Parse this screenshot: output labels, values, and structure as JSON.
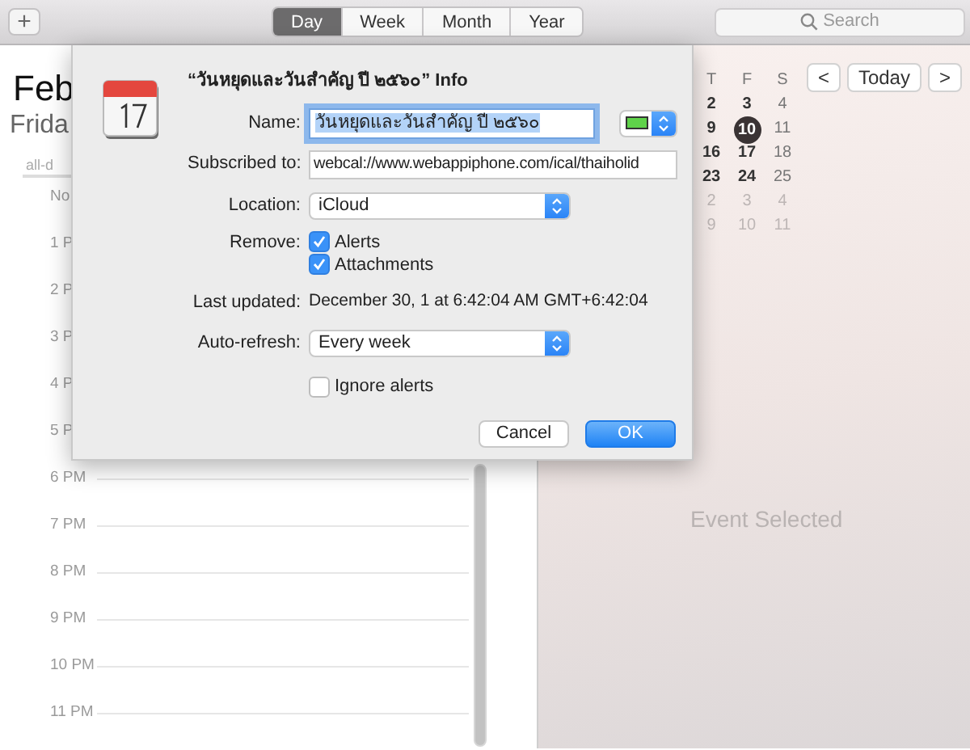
{
  "toolbar": {
    "add_button": "+",
    "view_tabs": [
      {
        "label": "Day",
        "selected": true
      },
      {
        "label": "Week",
        "selected": false
      },
      {
        "label": "Month",
        "selected": false
      },
      {
        "label": "Year",
        "selected": false
      }
    ],
    "search": {
      "placeholder": "Search"
    }
  },
  "day_view": {
    "month": "Feb",
    "weekday": "Frida",
    "all_day": "all-d",
    "hours": [
      "No",
      "1 P",
      "2 P",
      "3 P",
      "4 P",
      "5 P",
      "6 PM",
      "7 PM",
      "8 PM",
      "9 PM",
      "10 PM",
      "11 PM"
    ]
  },
  "mini_calendar": {
    "weekdays": [
      "T",
      "F",
      "S"
    ],
    "weeks": [
      [
        {
          "text": "2",
          "kind": "current",
          "selected": false
        },
        {
          "text": "3",
          "kind": "current",
          "selected": false
        },
        {
          "text": "4",
          "kind": "weekend",
          "selected": false
        }
      ],
      [
        {
          "text": "9",
          "kind": "current",
          "selected": false
        },
        {
          "text": "10",
          "kind": "current",
          "selected": true
        },
        {
          "text": "11",
          "kind": "weekend",
          "selected": false
        }
      ],
      [
        {
          "text": "16",
          "kind": "current",
          "selected": false
        },
        {
          "text": "17",
          "kind": "current",
          "selected": false
        },
        {
          "text": "18",
          "kind": "weekend",
          "selected": false
        }
      ],
      [
        {
          "text": "23",
          "kind": "current",
          "selected": false
        },
        {
          "text": "24",
          "kind": "current",
          "selected": false
        },
        {
          "text": "25",
          "kind": "weekend",
          "selected": false
        }
      ],
      [
        {
          "text": "2",
          "kind": "other",
          "selected": false
        },
        {
          "text": "3",
          "kind": "other",
          "selected": false
        },
        {
          "text": "4",
          "kind": "other",
          "selected": false
        }
      ],
      [
        {
          "text": "9",
          "kind": "other",
          "selected": false
        },
        {
          "text": "10",
          "kind": "other",
          "selected": false
        },
        {
          "text": "11",
          "kind": "other",
          "selected": false
        }
      ]
    ]
  },
  "navigation": {
    "previous": "<",
    "today": "Today",
    "next": ">"
  },
  "inspector": {
    "message": "Event Selected"
  },
  "dialog": {
    "title": "“วันหยุดและวันสำคัญ ปี ๒๕๖๐” Info",
    "name": {
      "label": "Name:",
      "value": "วันหยุดและวันสำคัญ ปี ๒๕๖๐",
      "selected": true,
      "color": "#5fd34a"
    },
    "subscribed": {
      "label": "Subscribed to:",
      "value": "webcal://www.webappiphone.com/ical/thaiholid"
    },
    "location": {
      "label": "Location:",
      "value": "iCloud"
    },
    "remove": {
      "label": "Remove:",
      "options": [
        {
          "label": "Alerts",
          "checked": true
        },
        {
          "label": "Attachments",
          "checked": true
        }
      ]
    },
    "last_updated": {
      "label": "Last updated:",
      "value": "December 30, 1 at 6:42:04 AM GMT+6:42:04"
    },
    "auto_refresh": {
      "label": "Auto-refresh:",
      "value": "Every week"
    },
    "ignore_alerts": {
      "label": "Ignore alerts",
      "checked": false
    },
    "buttons": [
      {
        "label": "Cancel",
        "kind": "secondary"
      },
      {
        "label": "OK",
        "kind": "primary"
      }
    ]
  }
}
